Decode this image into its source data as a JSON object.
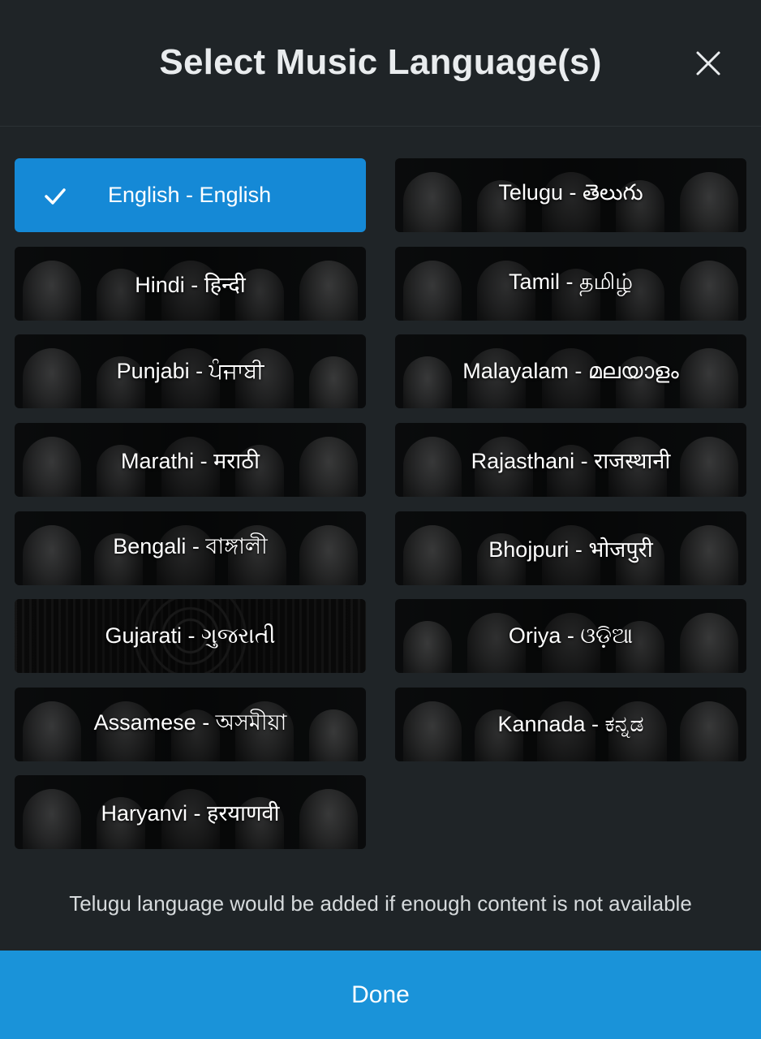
{
  "header": {
    "title": "Select Music Language(s)",
    "close_icon": "close-icon"
  },
  "languages": [
    {
      "label": "English - English",
      "selected": true
    },
    {
      "label": "Telugu - తెలుగు",
      "selected": false
    },
    {
      "label": "Hindi - हिन्दी",
      "selected": false
    },
    {
      "label": "Tamil - தமிழ்",
      "selected": false
    },
    {
      "label": "Punjabi - ਪੰਜਾਬੀ",
      "selected": false
    },
    {
      "label": "Malayalam - മലയാളം",
      "selected": false
    },
    {
      "label": "Marathi - मराठी",
      "selected": false
    },
    {
      "label": "Rajasthani - राजस्थानी",
      "selected": false
    },
    {
      "label": "Bengali - বাঙ্গালী",
      "selected": false
    },
    {
      "label": "Bhojpuri - भोजपुरी",
      "selected": false
    },
    {
      "label": "Gujarati - ગુજરાતી",
      "selected": false
    },
    {
      "label": "Oriya - ଓଡ଼ିଆ",
      "selected": false
    },
    {
      "label": "Assamese - অসমীয়া",
      "selected": false
    },
    {
      "label": "Kannada - ಕನ್ನಡ",
      "selected": false
    },
    {
      "label": "Haryanvi - हरयाणवी",
      "selected": false
    }
  ],
  "notice": "Telugu language would be added if enough content is not available",
  "done_label": "Done",
  "colors": {
    "background": "#1f2427",
    "selected_tile": "#1589d6",
    "done_button": "#1a93d9",
    "title_text": "#e9ecee"
  }
}
